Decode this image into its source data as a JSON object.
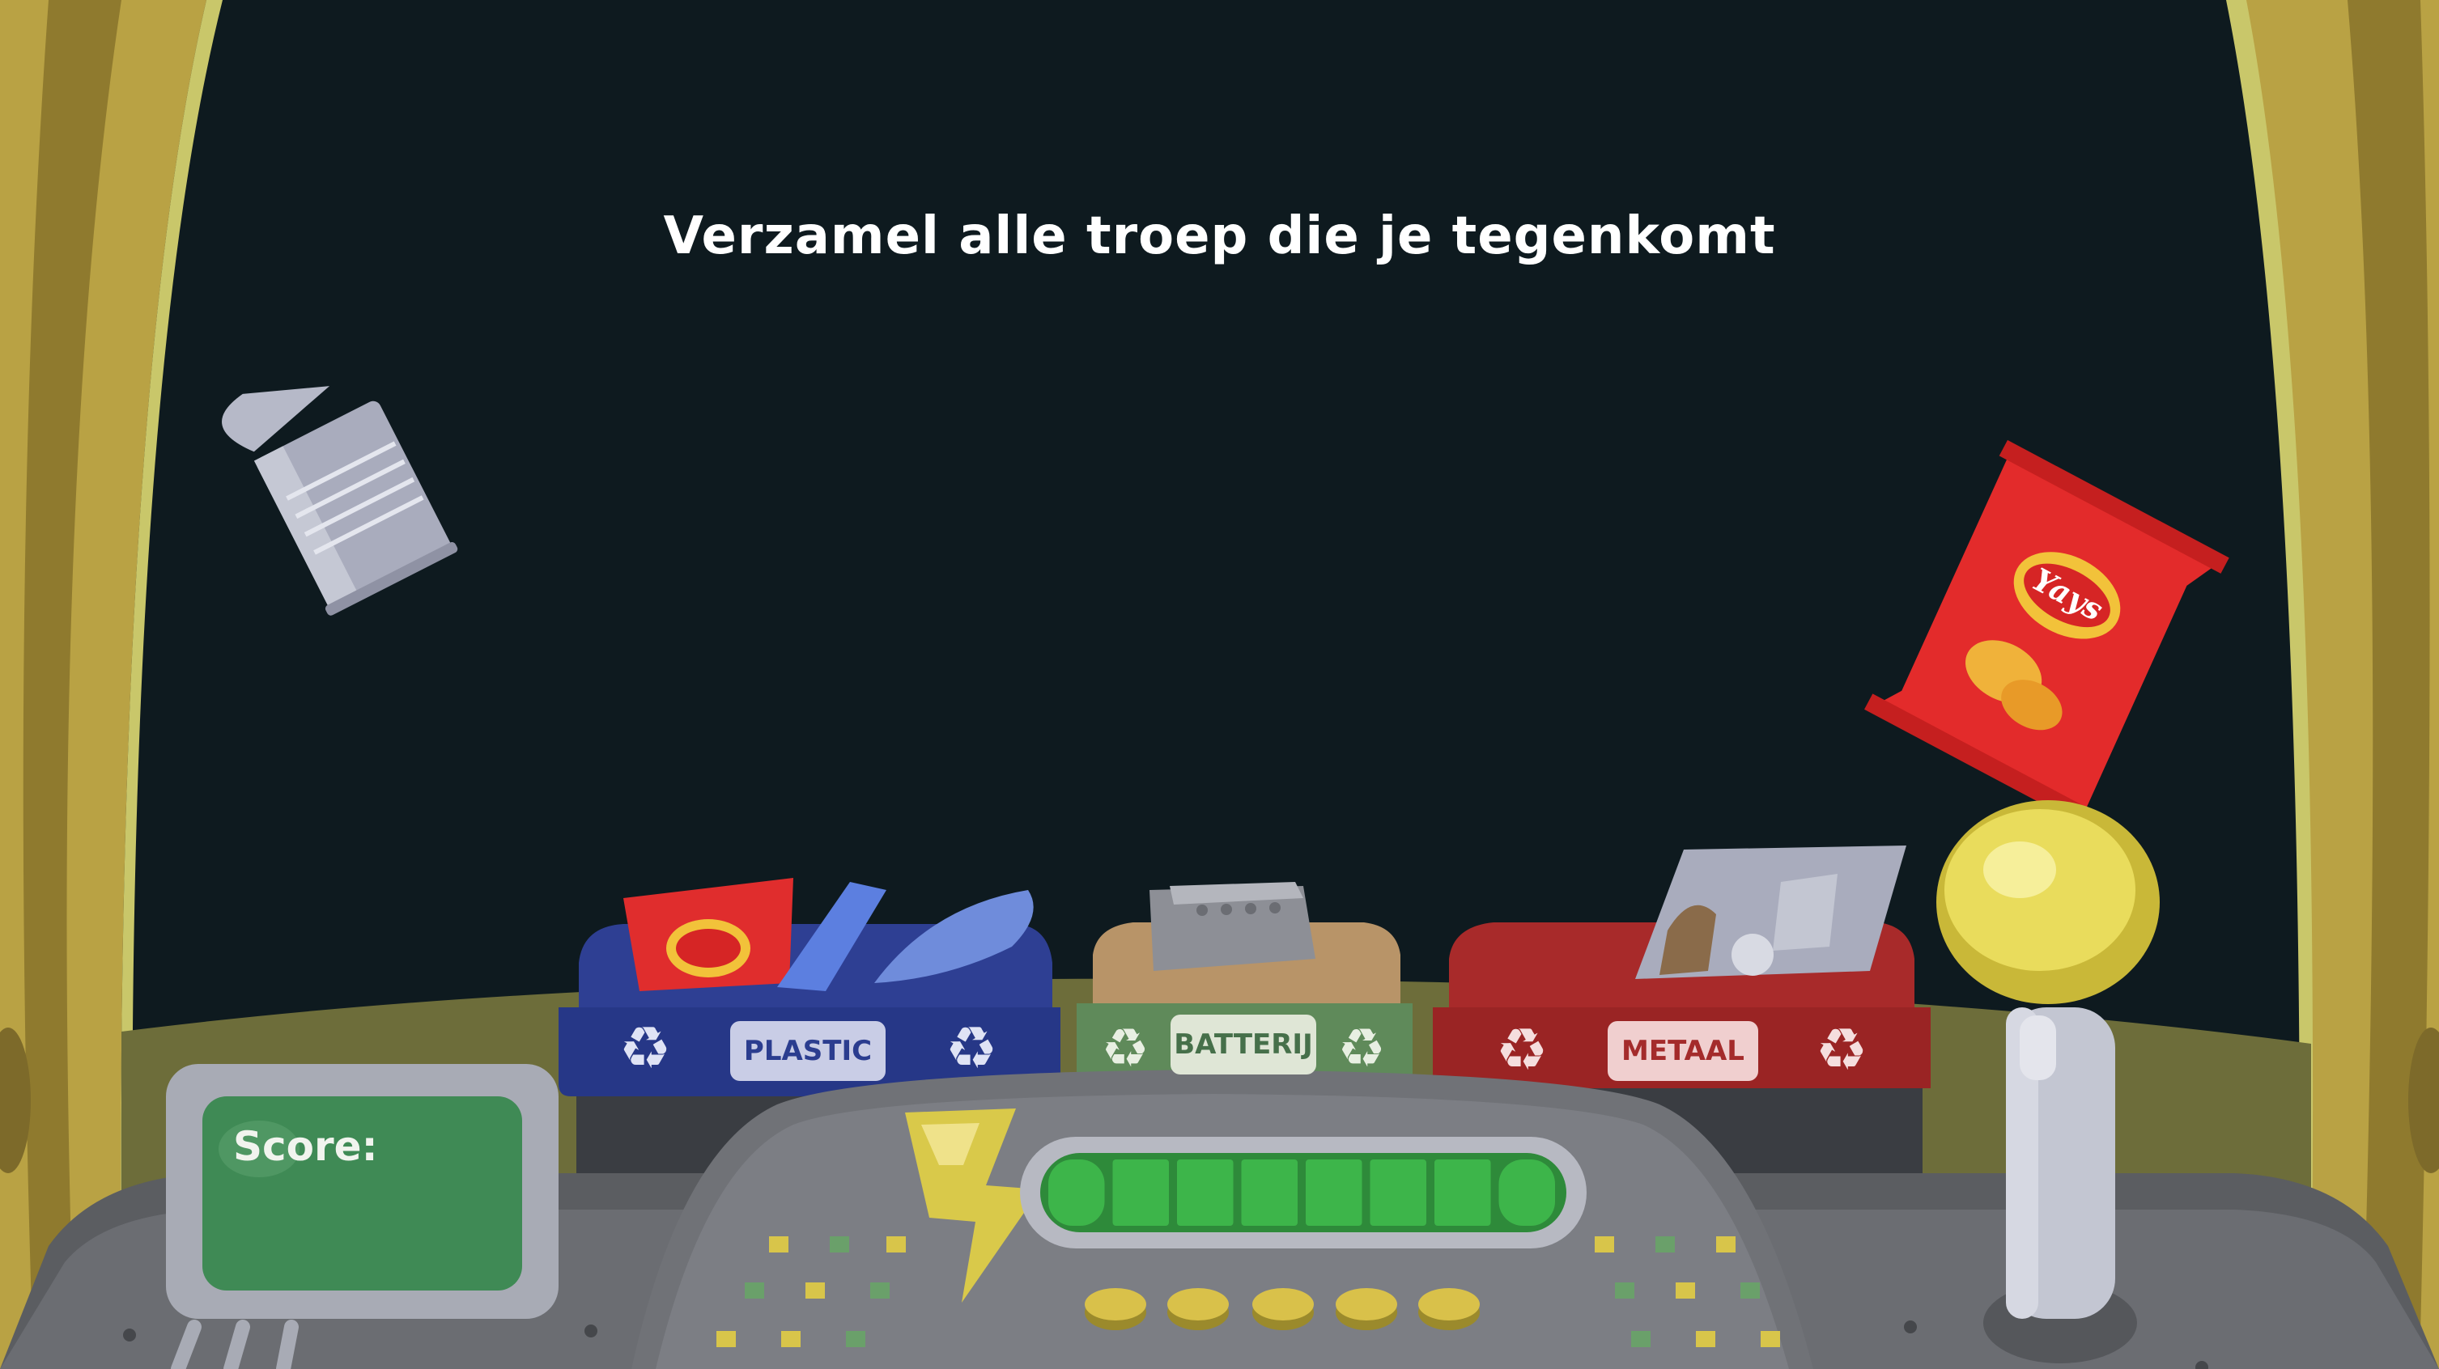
{
  "instruction": "Verzamel alle troep die je tegenkomt",
  "score": {
    "label": "Score:"
  },
  "bins": [
    {
      "label": "PLASTIC",
      "color": "#2b3d8f"
    },
    {
      "label": "BATTERIJ",
      "color": "#5f8a5a"
    },
    {
      "label": "METAAL",
      "color": "#a82a2a"
    }
  ],
  "floating_items": [
    "tin-can",
    "chips-bag"
  ],
  "brand_on_bag": "Yays",
  "energy": {
    "segments_filled": 8,
    "segments_total": 8
  },
  "colors": {
    "space": "#0e1a1f",
    "hull": "#b9a244",
    "screen": "#3f8a55",
    "energy": "#3db54a"
  }
}
